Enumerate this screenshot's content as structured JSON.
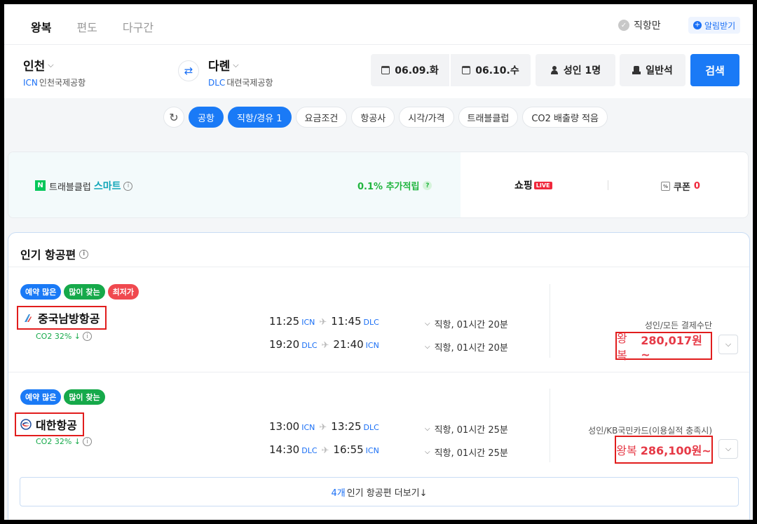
{
  "trip_tabs": [
    "왕복",
    "편도",
    "다구간"
  ],
  "direct_only_label": "직항만",
  "alert_label": "알림받기",
  "origin": {
    "city": "인천",
    "code": "ICN",
    "airport": "인천국제공항"
  },
  "destination": {
    "city": "다롄",
    "code": "DLC",
    "airport": "대련국제공항"
  },
  "depart_date": "06.09.화",
  "return_date": "06.10.수",
  "passengers": "성인 1명",
  "cabin": "일반석",
  "search_label": "검색",
  "filters": [
    {
      "label": "공항",
      "active": true
    },
    {
      "label": "직항/경유 1",
      "active": true
    },
    {
      "label": "요금조건",
      "active": false
    },
    {
      "label": "항공사",
      "active": false
    },
    {
      "label": "시각/가격",
      "active": false
    },
    {
      "label": "트래블클럽",
      "active": false
    },
    {
      "label": "CO2 배출량 적음",
      "active": false
    }
  ],
  "banner": {
    "n_logo": "N",
    "club_text": "트래블클럽",
    "smart_text": "스마트",
    "point_text": "0.1% 추가적립",
    "shopping_text": "쇼핑",
    "live_text": "LIVE",
    "coupon_label": "쿠폰",
    "coupon_count": "0"
  },
  "popular": {
    "title": "인기 항공편",
    "show_more_count": "4개",
    "show_more_text": "인기 항공편 더보기↓",
    "flights": [
      {
        "tags": [
          "예약 많은",
          "많이 찾는",
          "최저가"
        ],
        "airline": "중국남방항공",
        "co2": "CO2 32% ↓",
        "legs": [
          {
            "dep_time": "11:25",
            "dep_ap": "ICN",
            "arr_time": "11:45",
            "arr_ap": "DLC",
            "info": "직항, 01시간 20분"
          },
          {
            "dep_time": "19:20",
            "dep_ap": "DLC",
            "arr_time": "21:40",
            "arr_ap": "ICN",
            "info": "직항, 01시간 20분"
          }
        ],
        "payment": "성인/모든 결제수단",
        "price_prefix": "왕복",
        "price": "280,017원~"
      },
      {
        "tags": [
          "예약 많은",
          "많이 찾는"
        ],
        "airline": "대한항공",
        "co2": "CO2 32% ↓",
        "legs": [
          {
            "dep_time": "13:00",
            "dep_ap": "ICN",
            "arr_time": "13:25",
            "arr_ap": "DLC",
            "info": "직항, 01시간 25분"
          },
          {
            "dep_time": "14:30",
            "dep_ap": "DLC",
            "arr_time": "16:55",
            "arr_ap": "ICN",
            "info": "직항, 01시간 25분"
          }
        ],
        "payment": "성인/KB국민카드(이용실적 충족시)",
        "price_prefix": "왕복",
        "price": "286,100원~"
      }
    ]
  },
  "colors": {
    "accent": "#1a7af6",
    "price": "#e63946",
    "green": "#16a94a",
    "highlight_box": "#e11d1d"
  }
}
